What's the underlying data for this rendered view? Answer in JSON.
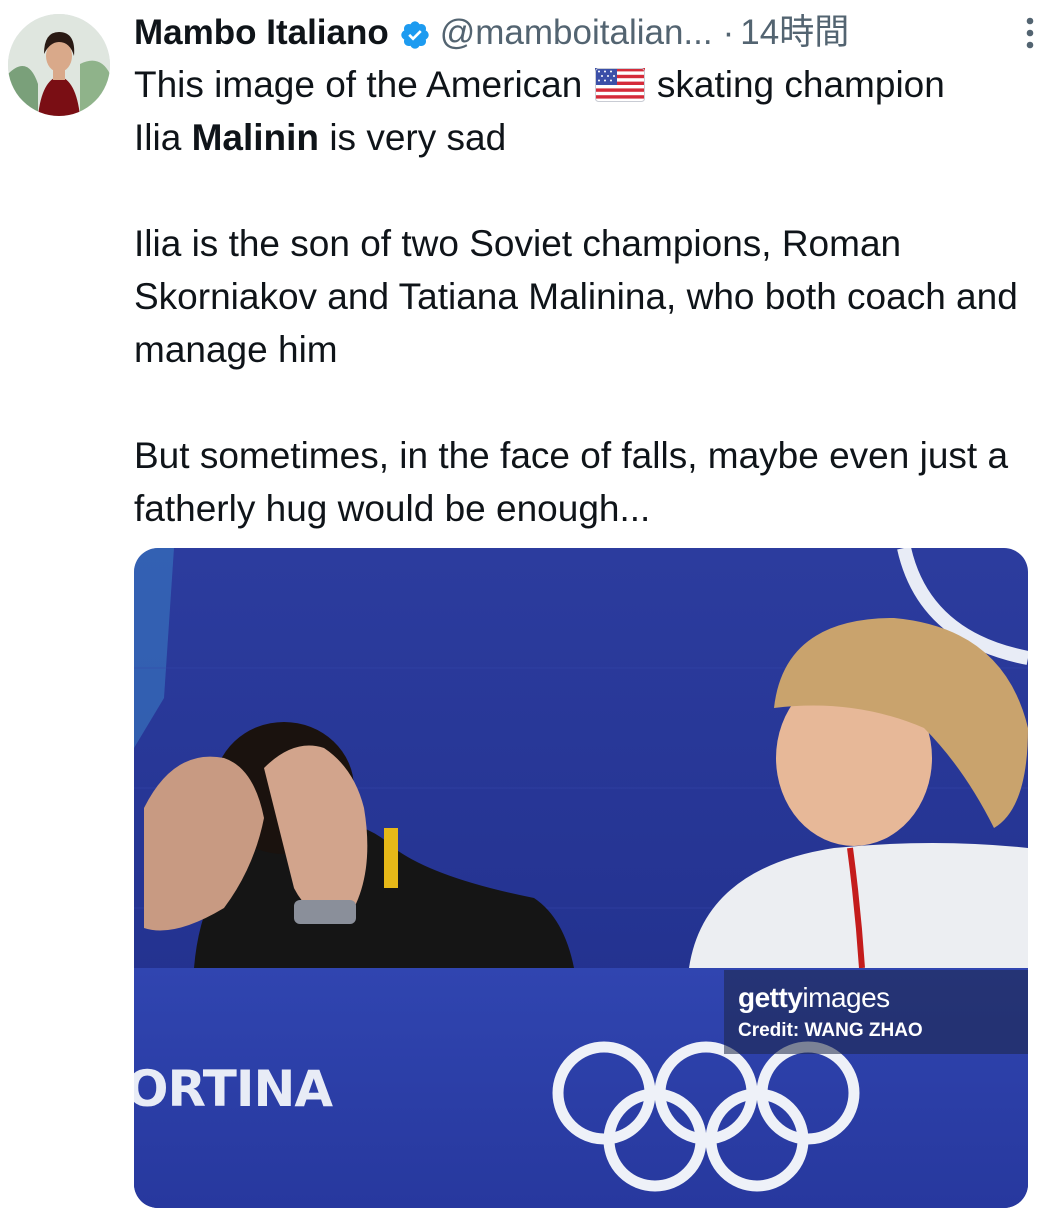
{
  "tweet": {
    "author": {
      "display_name": "Mambo Italiano",
      "handle": "@mamboitalian...",
      "avatar_icon": "profile-photo-avatar",
      "verified_icon": "verified-badge-icon",
      "verified_color": "#1d9bf0"
    },
    "separator": "·",
    "timestamp": "14時間",
    "more_icon": "more-vertical-icon",
    "text": {
      "line1_before_flag": "This image of the American",
      "flag_icon": "us-flag-emoji",
      "line1_after_flag": "skating champion",
      "line2_prefix": "Ilia",
      "line2_bold": "Malinin",
      "line2_suffix": "is very sad",
      "paragraph2": "Ilia is the son of two Soviet champions, Roman Skorniakov and Tatiana Malinina, who both coach and manage him",
      "paragraph3": "But sometimes, in the face of falls, maybe even just a fatherly hug would be enough..."
    },
    "media": {
      "watermark_brand_bold": "getty",
      "watermark_brand_light": "images",
      "watermark_credit": "Credit: WANG ZHAO",
      "venue_text": "ORTINA",
      "olympic_rings_icon": "olympic-rings-icon"
    }
  },
  "colors": {
    "text_primary": "#0f1419",
    "text_secondary": "#536471",
    "accent": "#1d9bf0",
    "backdrop_blue": "#2a3a9c"
  }
}
